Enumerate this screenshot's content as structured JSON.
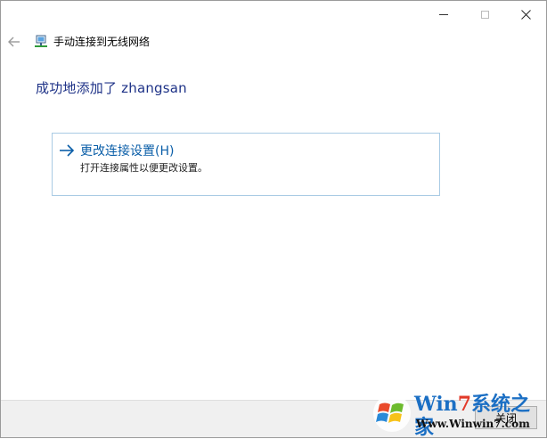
{
  "window": {
    "title": "手动连接到无线网络",
    "controls": {
      "minimize": "minimize-icon",
      "maximize": "maximize-icon",
      "close": "close-icon"
    }
  },
  "header": {
    "back_icon": "back-arrow-icon",
    "network_icon": "wireless-network-icon"
  },
  "main": {
    "success_message": "成功地添加了 zhangsan",
    "command_link": {
      "icon": "right-arrow-icon",
      "title": "更改连接设置(H)",
      "description": "打开连接属性以便更改设置。"
    }
  },
  "footer": {
    "close_label": "关闭"
  },
  "watermark": {
    "line1": "系统之家",
    "line1_prefix": "Win",
    "line1_seven": "7",
    "line2": "Www.Winwin7.com"
  },
  "colors": {
    "heading": "#1e3287",
    "link": "#0a5ea8",
    "link_border": "#a9cbe4",
    "footer_bg": "#f0f0f0"
  }
}
